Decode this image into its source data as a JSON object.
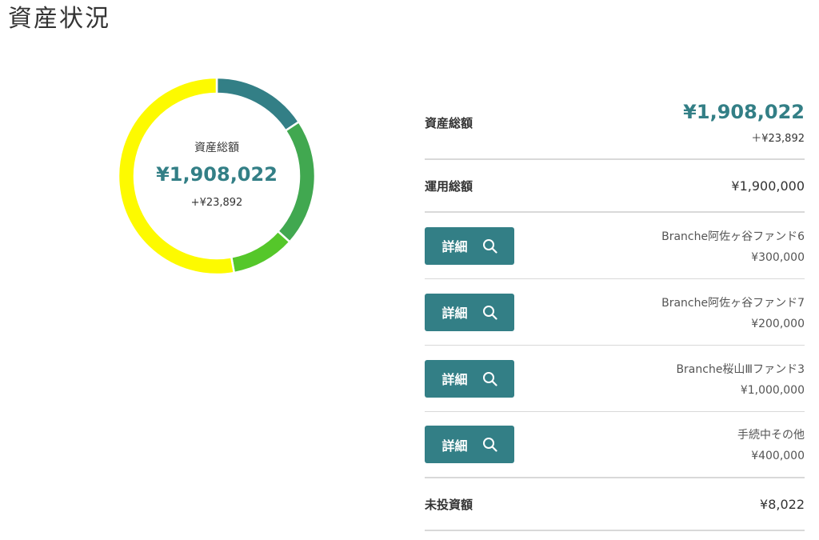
{
  "page": {
    "title": "資産状況"
  },
  "donut": {
    "label": "資産総額",
    "amount": "¥1,908,022",
    "delta": "+¥23,892",
    "segments": [
      {
        "value": 300000,
        "color": "#337f86"
      },
      {
        "value": 400000,
        "color": "#41a850"
      },
      {
        "value": 200000,
        "color": "#55c72a"
      },
      {
        "value": 1008022,
        "color": "#fdfa00"
      }
    ]
  },
  "summary": {
    "total": {
      "label": "資産総額",
      "amount": "¥1,908,022",
      "delta": "＋¥23,892"
    },
    "invested": {
      "label": "運用総額",
      "amount": "¥1,900,000"
    },
    "detail_label": "詳細",
    "funds": [
      {
        "name": "Branche阿佐ヶ谷ファンド6",
        "value": "¥300,000"
      },
      {
        "name": "Branche阿佐ヶ谷ファンド7",
        "value": "¥200,000"
      },
      {
        "name": "Branche桜山Ⅲファンド3",
        "value": "¥1,000,000"
      },
      {
        "name": "手続中その他",
        "value": "¥400,000"
      }
    ],
    "cash": {
      "label": "未投資額",
      "amount": "¥8,022"
    }
  },
  "colors": {
    "accent": "#337f86",
    "divider": "#d9d9d9"
  }
}
